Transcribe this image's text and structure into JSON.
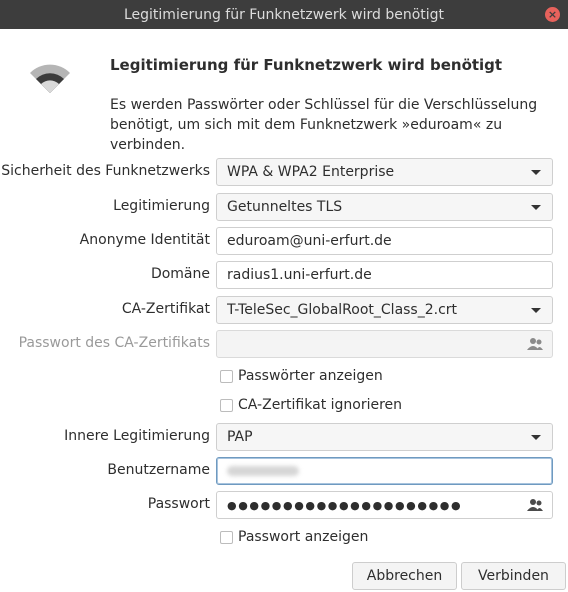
{
  "window": {
    "title": "Legitimierung für Funknetzwerk wird benötigt",
    "close_icon": "close-icon"
  },
  "header": {
    "icon": "wifi-icon",
    "title": "Legitimierung für Funknetzwerk wird benötigt",
    "description": "Es werden Passwörter oder Schlüssel für die Verschlüsselung benötigt, um sich mit dem Funknetzwerk »eduroam« zu verbinden."
  },
  "form": {
    "security_label": "Sicherheit des Funknetzwerks",
    "security_value": "WPA & WPA2 Enterprise",
    "auth_label": "Legitimierung",
    "auth_value": "Getunneltes TLS",
    "anon_identity_label": "Anonyme Identität",
    "anon_identity_value": "eduroam@uni-erfurt.de",
    "domain_label": "Domäne",
    "domain_value": "radius1.uni-erfurt.de",
    "ca_cert_label": "CA-Zertifikat",
    "ca_cert_value": "T-TeleSec_GlobalRoot_Class_2.crt",
    "ca_password_label": "Passwort des CA-Zertifikats",
    "ca_password_value": "",
    "show_passwords_label": "Passwörter anzeigen",
    "ignore_ca_label": "CA-Zertifikat ignorieren",
    "inner_auth_label": "Innere Legitimierung",
    "inner_auth_value": "PAP",
    "username_label": "Benutzername",
    "username_value": "",
    "password_label": "Passwort",
    "password_value": "●●●●●●●●●●●●●●●●●●●●●",
    "show_password_label": "Passwort anzeigen"
  },
  "buttons": {
    "cancel": "Abbrechen",
    "connect": "Verbinden"
  },
  "colors": {
    "titlebar_bg": "#3d3d3d",
    "close_button": "#e7625c",
    "focus_border": "#6f9ac0"
  }
}
